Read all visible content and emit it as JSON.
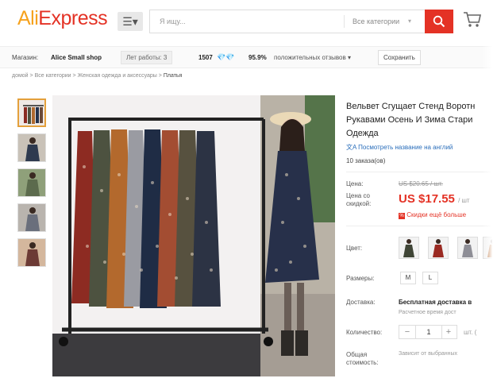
{
  "header": {
    "logo_part1": "Ali",
    "logo_part2": "Express",
    "category_button": "☰▾",
    "search_placeholder": "Я ищу...",
    "search_category": "Все категории",
    "search_caret": "▾",
    "accent_color": "#e43225"
  },
  "store_bar": {
    "label": "Магазин:",
    "shop_name": "Alice Small shop",
    "years": "Лет работы: 3",
    "count": "1507",
    "diamonds": "💎💎",
    "rating": "95.9%",
    "reviews": "положительных отзывов ▾",
    "save": "Сохранить"
  },
  "breadcrumb": {
    "items": [
      "домой",
      "Все категории",
      "Женская одежда и аксессуары"
    ],
    "separator": ">",
    "last": "Платья"
  },
  "product": {
    "title_lines": [
      "Вельвет Сгущает Стенд Воротн",
      "Рукавами Осень И Зима Стари",
      "Одежда"
    ],
    "translate_link": "Посмотреть название на англий",
    "orders": "10 заказа(ов)",
    "price_label": "Цена:",
    "old_price": "US $20.65 / шт.",
    "discount_price_label_1": "Цена со",
    "discount_price_label_2": "скидкой:",
    "new_price": "US $17.55",
    "per_unit": "/ шт",
    "discount_text": "Скидки ещё больше",
    "color_label": "Цвет:",
    "sizes_label": "Размеры:",
    "sizes": [
      "M",
      "L"
    ],
    "shipping_label": "Доставка:",
    "shipping_value": "Бесплатная доставка в",
    "shipping_time": "Расчетное время дост",
    "quantity_label": "Количество:",
    "quantity_minus": "−",
    "quantity_value": "1",
    "quantity_plus": "+",
    "quantity_unit": "шт. (",
    "total_label_1": "Общая",
    "total_label_2": "стоимость:",
    "total_value": "Зависит от выбранных"
  }
}
